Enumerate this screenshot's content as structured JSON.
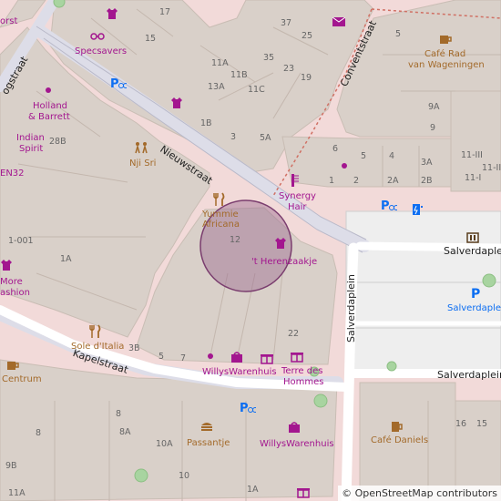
{
  "map": {
    "streets": {
      "nieuwstraat": "Nieuwstraat",
      "kapelstraat": "Kapelstraat",
      "salverdaplein": "Salverdaplein",
      "salverdaplein2": "Salverdaplein",
      "salverdaplein_v": "Salverdaplein",
      "conventstraat": "Conventstraat",
      "hoogstraat_part": "ogstraat"
    },
    "pois": {
      "specsavers": "Specsavers",
      "holland_barrett_1": "Holland",
      "holland_barrett_2": "& Barrett",
      "indian_spirit_1": "Indian",
      "indian_spirit_2": "Spirit",
      "nji_sri": "Nji Sri",
      "cafe_rad_1": "Café Rad",
      "cafe_rad_2": "van Wageningen",
      "synergy_1": "Synergy",
      "synergy_2": "Hair",
      "yummie_1": "Yummie",
      "yummie_2": "Africana",
      "herenzaakje": "'t Herenzaakje",
      "sole_italia": "Sole d'Italia",
      "willys_1": "WillysWarenhuis",
      "terre_1": "Terre des",
      "terre_2": "Hommes",
      "centrum": "Centrum",
      "passantje": "Passantje",
      "willys_2": "WillysWarenhuis",
      "cafe_daniels": "Café Daniels",
      "en32": "EN32",
      "more_1": "More",
      "more_2": "ashion",
      "orst": "orst",
      "p_label": "P",
      "salverdaplein_p": "Salverdaplein"
    },
    "house_numbers": {
      "n17": "17",
      "n15": "15",
      "n37": "37",
      "n25": "25",
      "n5": "5",
      "n35": "35",
      "n23": "23",
      "n19": "19",
      "n11A": "11A",
      "n11B": "11B",
      "n13A": "13A",
      "n11C": "11C",
      "n1B": "1B",
      "n3": "3",
      "n5A": "5A",
      "n9A": "9A",
      "n9": "9",
      "n28B": "28B",
      "n6": "6",
      "n5b": "5",
      "n4": "4",
      "n3A": "3A",
      "n1": "1",
      "n2": "2",
      "n2A": "2A",
      "n2B": "2B",
      "n11_III": "11-III",
      "n11_II": "11-II",
      "n11_I": "11-I",
      "n12": "12",
      "n1_001": "1-001",
      "n1A": "1A",
      "n3B": "3B",
      "n5c": "5",
      "n7": "7",
      "n22": "22",
      "n8": "8",
      "n8A": "8A",
      "n10A": "10A",
      "n10": "10",
      "n16": "16",
      "n15b": "15",
      "n9B": "9B",
      "n11A2": "11A",
      "n1A2": "1A",
      "n18": "8"
    },
    "selection_circle": {
      "fill": "#9b6b90",
      "stroke": "#7a3d6e"
    },
    "colors": {
      "land": "#f2dad9",
      "building": "#d9d0c9",
      "road": "#ffffff",
      "pedestrian": "#dddde8",
      "parking": "#eeeeee",
      "poi_purple": "#a3168f",
      "poi_brown": "#a36a2a",
      "parking_blue": "#0c6ef2"
    },
    "attribution": "© OpenStreetMap contributors"
  }
}
